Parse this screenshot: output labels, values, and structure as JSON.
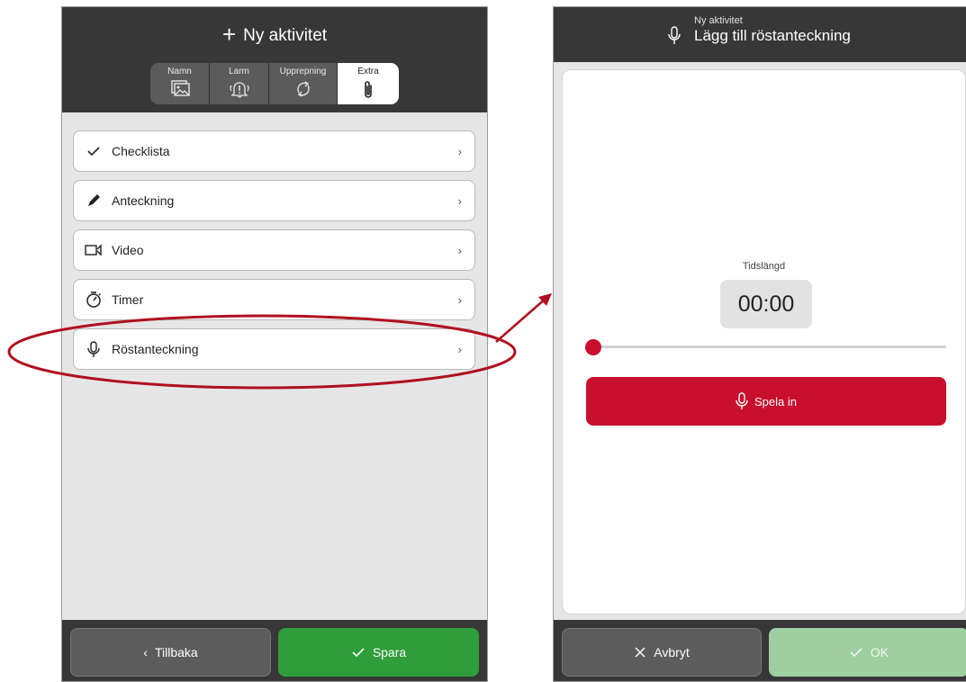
{
  "left": {
    "title": "Ny aktivitet",
    "tabs": [
      {
        "label": "Namn",
        "icon": "image-icon"
      },
      {
        "label": "Larm",
        "icon": "bell-alert-icon"
      },
      {
        "label": "Upprepning",
        "icon": "repeat-icon"
      },
      {
        "label": "Extra",
        "icon": "paperclip-icon",
        "active": true
      }
    ],
    "items": [
      {
        "label": "Checklista",
        "icon": "check-icon"
      },
      {
        "label": "Anteckning",
        "icon": "pencil-icon"
      },
      {
        "label": "Video",
        "icon": "video-icon"
      },
      {
        "label": "Timer",
        "icon": "stopwatch-icon"
      },
      {
        "label": "Röstanteckning",
        "icon": "microphone-icon"
      }
    ],
    "chevron": "›",
    "back_label": "Tillbaka",
    "save_label": "Spara"
  },
  "right": {
    "subtitle": "Ny aktivitet",
    "title": "Lägg till röstanteckning",
    "duration_label": "Tidslängd",
    "duration_value": "00:00",
    "slider_position": 0,
    "record_label": "Spela in",
    "cancel_label": "Avbryt",
    "ok_label": "OK"
  },
  "colors": {
    "header": "#373737",
    "accent_red": "#c8102e",
    "save_green": "#2e9d3a",
    "ok_green_disabled": "#9fcfa0",
    "highlight_ellipse": "#b0101e"
  }
}
